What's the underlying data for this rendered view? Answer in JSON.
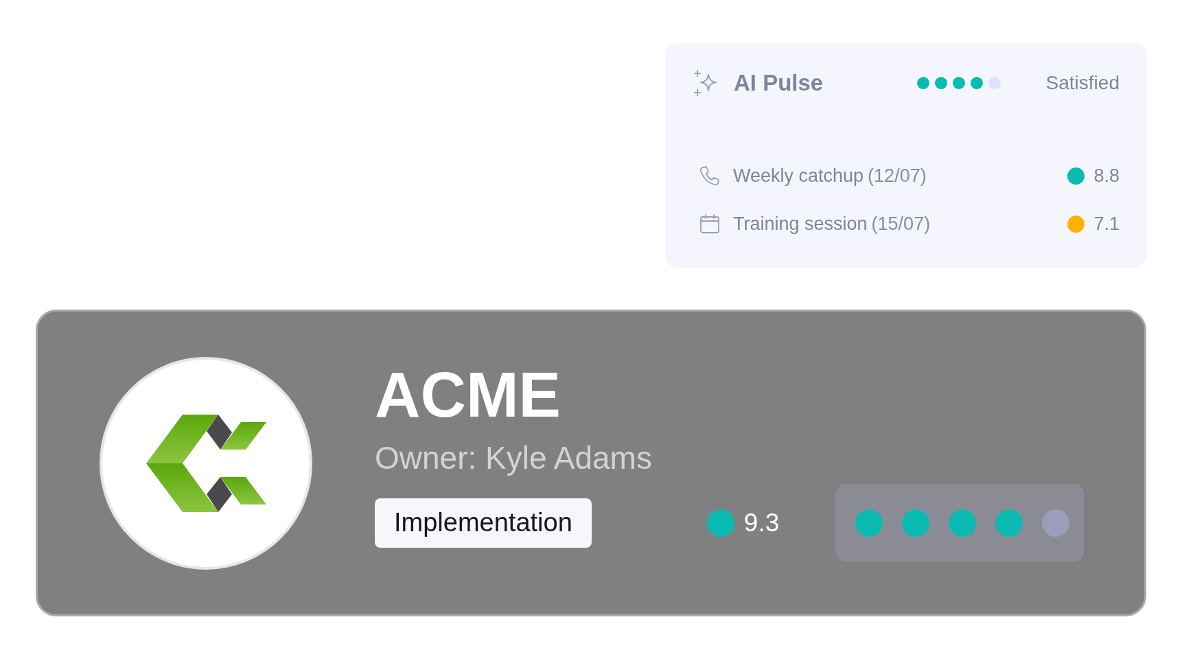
{
  "ai_pulse": {
    "title": "AI Pulse",
    "stars": 4,
    "status": "Satisfied",
    "meetings": [
      {
        "kind": "call",
        "title": "Weekly catchup",
        "date": "(12/07)",
        "color": "#0bbab0",
        "score": "8.8"
      },
      {
        "kind": "event",
        "title": "Training session",
        "date": "(15/07)",
        "color": "#ffb000",
        "score": "7.1"
      }
    ]
  },
  "account": {
    "name": "ACME",
    "owner": "Owner: Kyle Adams",
    "stage": "Implementation",
    "score": {
      "color": "#0bbab0",
      "value": "9.3"
    },
    "stars": 4
  }
}
